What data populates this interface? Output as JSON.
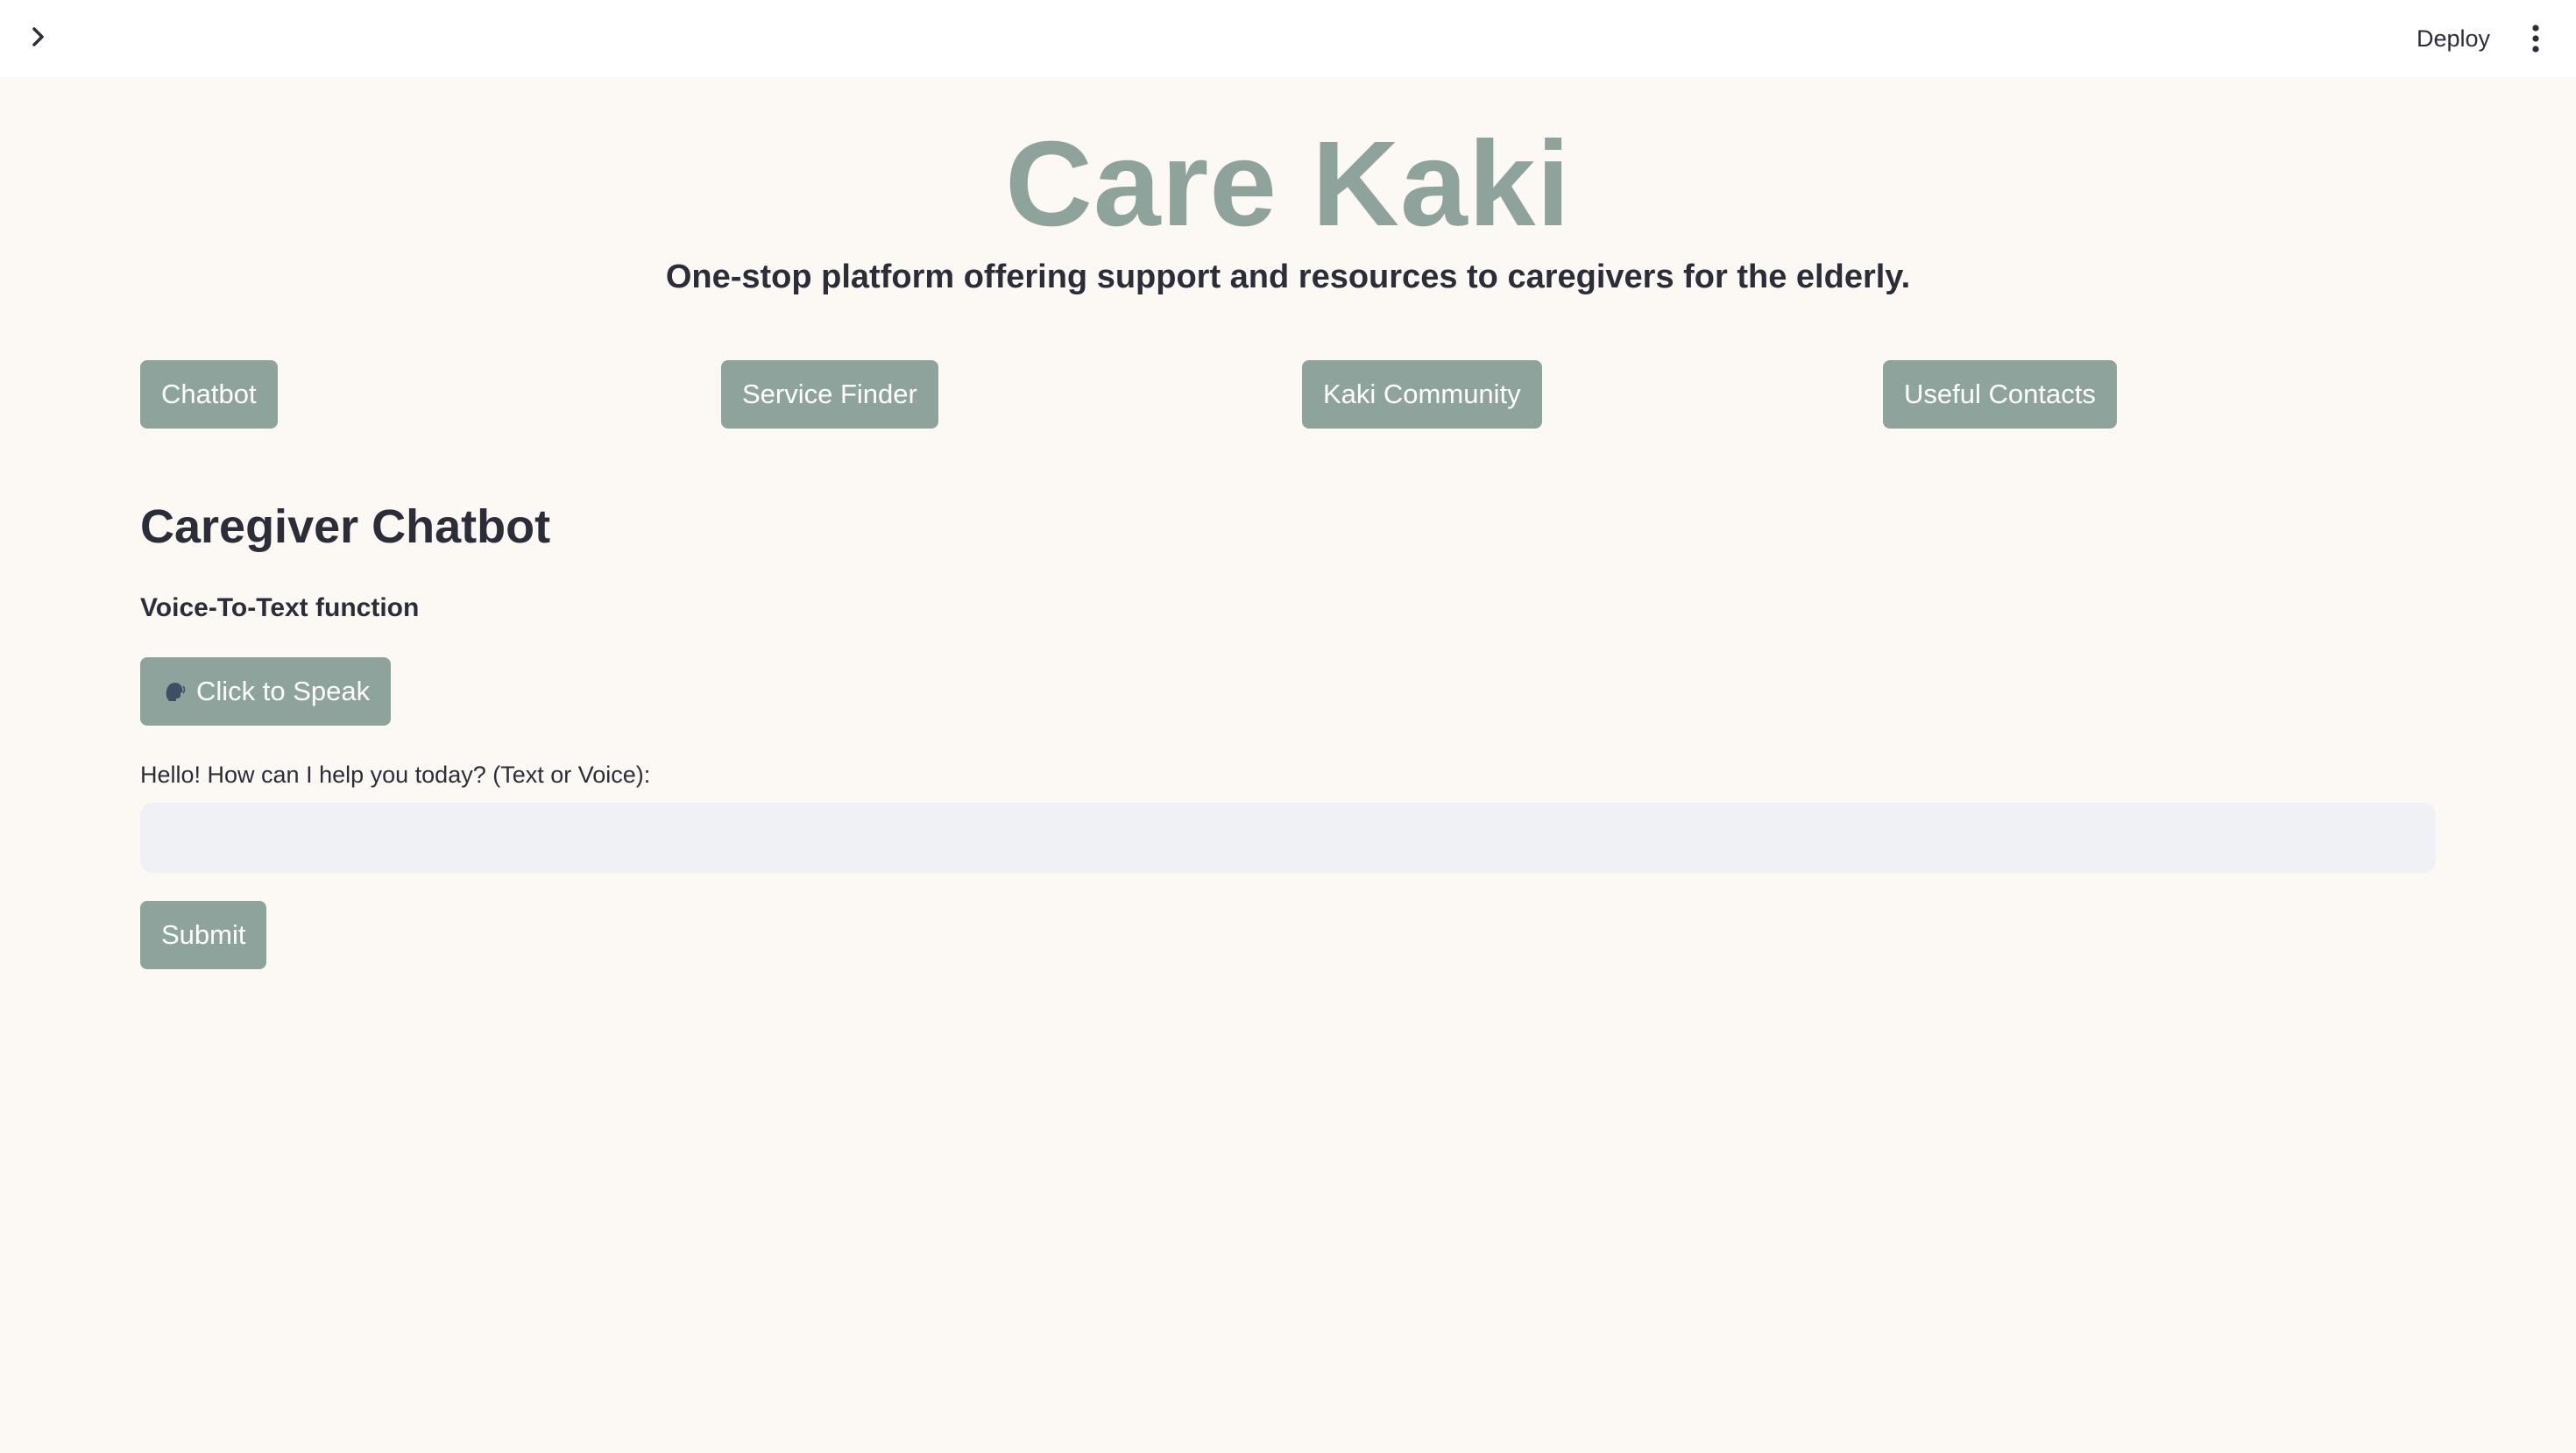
{
  "header": {
    "expand_icon": "chevron-right-icon",
    "deploy_label": "Deploy",
    "menu_icon": "more-vertical-icon"
  },
  "hero": {
    "title": "Care Kaki",
    "subtitle": "One-stop platform offering support and resources to caregivers for the elderly."
  },
  "nav": {
    "chatbot": "Chatbot",
    "service_finder": "Service Finder",
    "kaki_community": "Kaki Community",
    "useful_contacts": "Useful Contacts"
  },
  "chatbot": {
    "heading": "Caregiver Chatbot",
    "voice_label": "Voice-To-Text function",
    "speak_icon": "speaking-head-icon",
    "speak_label": "Click to Speak",
    "prompt_label": "Hello! How can I help you today? (Text or Voice):",
    "input_value": "",
    "submit_label": "Submit"
  },
  "colors": {
    "accent": "#8fa39d",
    "background": "#fcf8f3",
    "text": "#2b2d38",
    "input_bg": "#eff1f4"
  }
}
